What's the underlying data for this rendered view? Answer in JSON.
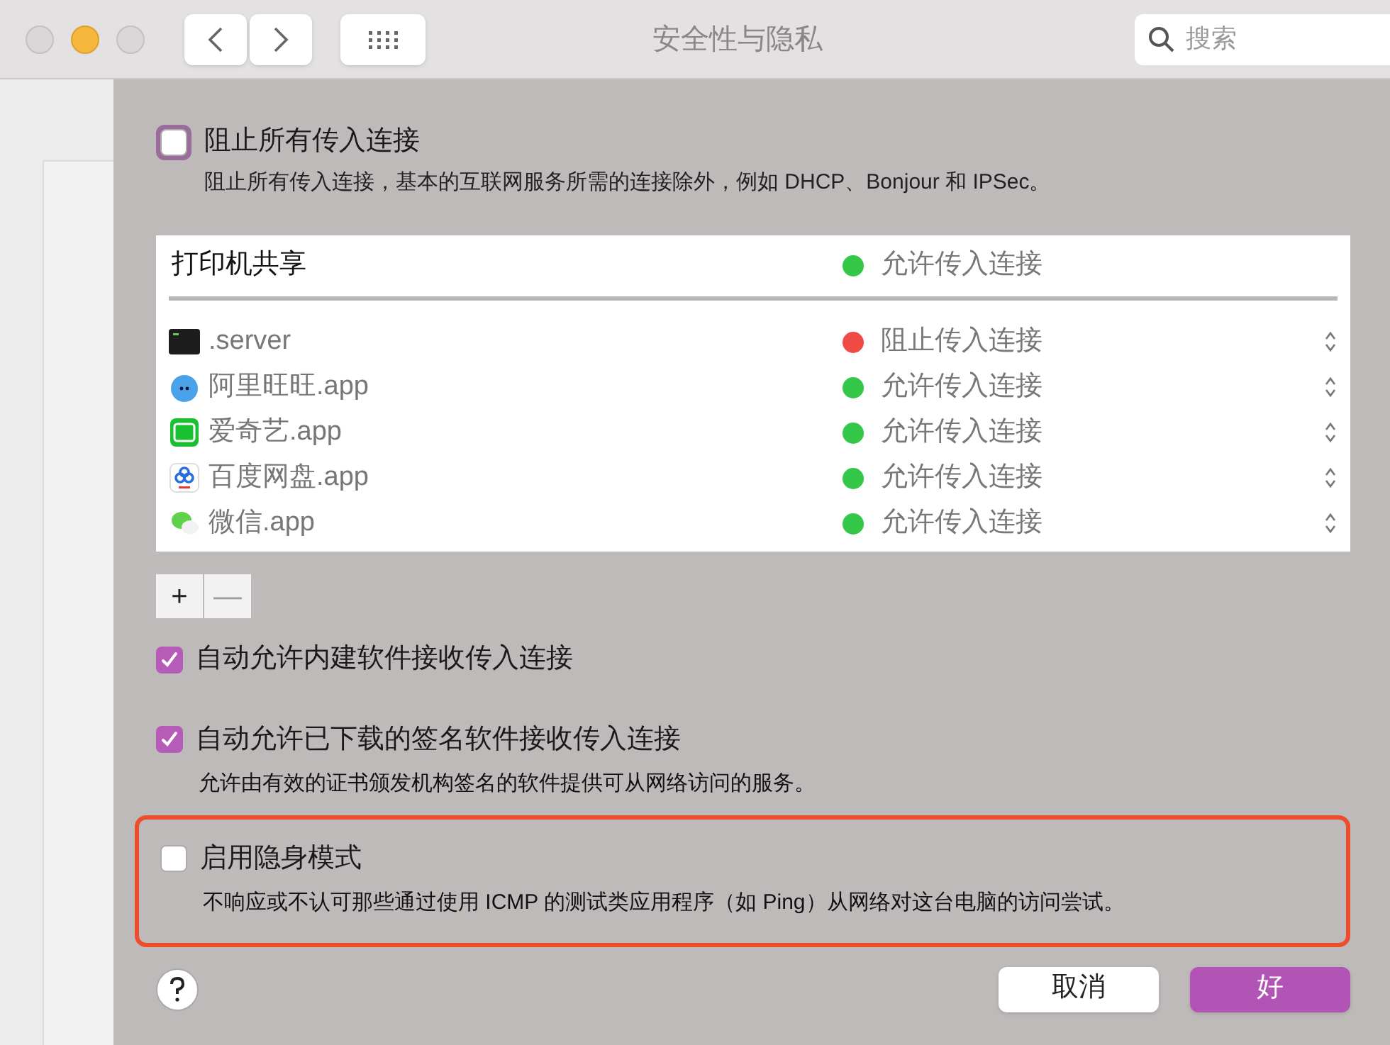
{
  "window": {
    "title": "安全性与隐私",
    "search": {
      "placeholder": "搜索"
    }
  },
  "block_all": {
    "label": "阻止所有传入连接",
    "checked": false,
    "focused": true,
    "description": "阻止所有传入连接，基本的互联网服务所需的连接除外，例如 DHCP、Bonjour 和 IPSec。"
  },
  "table": {
    "header": {
      "name": "打印机共享",
      "status": "允许传入连接",
      "color": "#34c748"
    },
    "rows": [
      {
        "kind": "terminal",
        "name": ".server",
        "status": "阻止传入连接",
        "color": "#f04a45"
      },
      {
        "kind": "wangwang",
        "name": "阿里旺旺.app",
        "status": "允许传入连接",
        "color": "#34c748"
      },
      {
        "kind": "iqiyi",
        "name": "爱奇艺.app",
        "status": "允许传入连接",
        "color": "#34c748"
      },
      {
        "kind": "baidu",
        "name": "百度网盘.app",
        "status": "允许传入连接",
        "color": "#34c748"
      },
      {
        "kind": "wechat",
        "name": "微信.app",
        "status": "允许传入连接",
        "color": "#34c748"
      }
    ]
  },
  "add_remove": [
    {
      "label": "+",
      "disabled": false
    },
    {
      "label": "—",
      "disabled": true
    }
  ],
  "options": [
    {
      "label": "自动允许内建软件接收传入连接",
      "checked": true,
      "highlighted": false
    },
    {
      "label": "自动允许已下载的签名软件接收传入连接",
      "checked": true,
      "description": "允许由有效的证书颁发机构签名的软件提供可从网络访问的服务。",
      "highlighted": false
    },
    {
      "label": "启用隐身模式",
      "checked": false,
      "description": "不响应或不认可那些通过使用 ICMP 的测试类应用程序（如 Ping）从网络对这台电脑的访问尝试。",
      "highlighted": true
    }
  ],
  "buttons": [
    {
      "label": "取消",
      "kind": "secondary"
    },
    {
      "label": "好",
      "kind": "primary"
    }
  ]
}
